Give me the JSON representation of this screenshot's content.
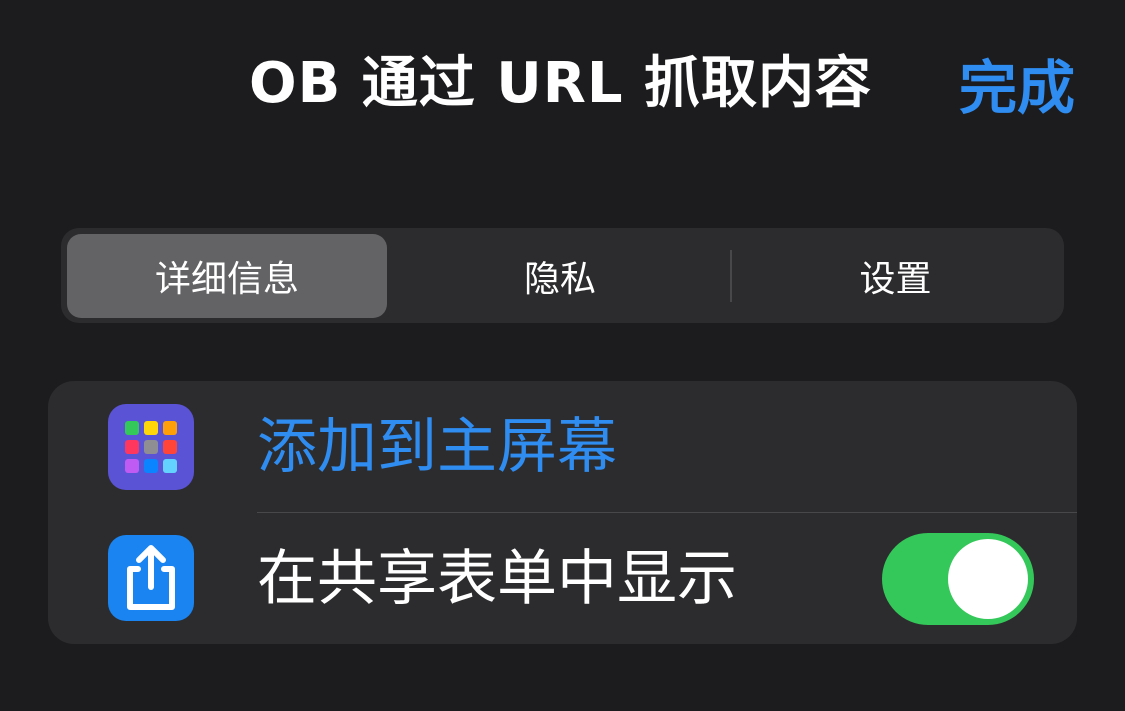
{
  "header": {
    "title": "OB 通过 URL 抓取内容",
    "done_label": "完成"
  },
  "segments": [
    {
      "label": "详细信息",
      "selected": true
    },
    {
      "label": "隐私",
      "selected": false
    },
    {
      "label": "设置",
      "selected": false
    }
  ],
  "list": {
    "add_to_home": {
      "label": "添加到主屏幕",
      "icon": "app-grid-icon"
    },
    "share_sheet": {
      "label": "在共享表单中显示",
      "icon": "share-icon",
      "toggle_on": true
    }
  },
  "colors": {
    "accent": "#2f8cf0",
    "toggle_on": "#34c759",
    "background": "#1c1c1e",
    "card": "#2c2c2e"
  }
}
